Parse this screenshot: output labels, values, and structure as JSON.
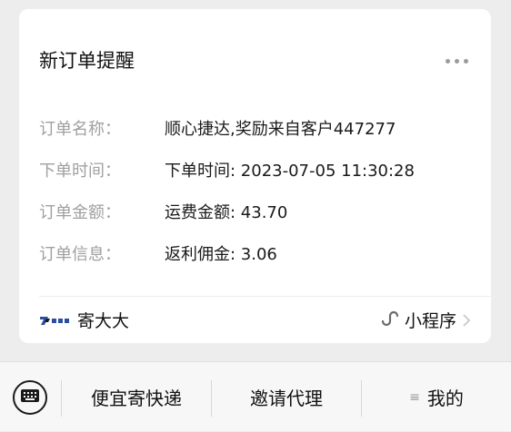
{
  "card": {
    "title": "新订单提醒",
    "rows": [
      {
        "label": "订单名称：",
        "value": "顺心捷达,奖励来自客户447277"
      },
      {
        "label": "下单时间：",
        "value": "下单时间: 2023-07-05 11:30:28"
      },
      {
        "label": "订单金额：",
        "value": "运费金额: 43.70"
      },
      {
        "label": "订单信息：",
        "value": "返利佣金: 3.06"
      }
    ],
    "source_name": "寄大大",
    "mini_program_label": "小程序"
  },
  "menu": {
    "items": [
      {
        "label": "便宜寄快递"
      },
      {
        "label": "邀请代理"
      },
      {
        "label": "我的"
      }
    ]
  },
  "colors": {
    "background": "#ededed",
    "card": "#ffffff",
    "label": "#a0a0a0",
    "text": "#1a1a1a",
    "logo": "#2a4fa0"
  }
}
